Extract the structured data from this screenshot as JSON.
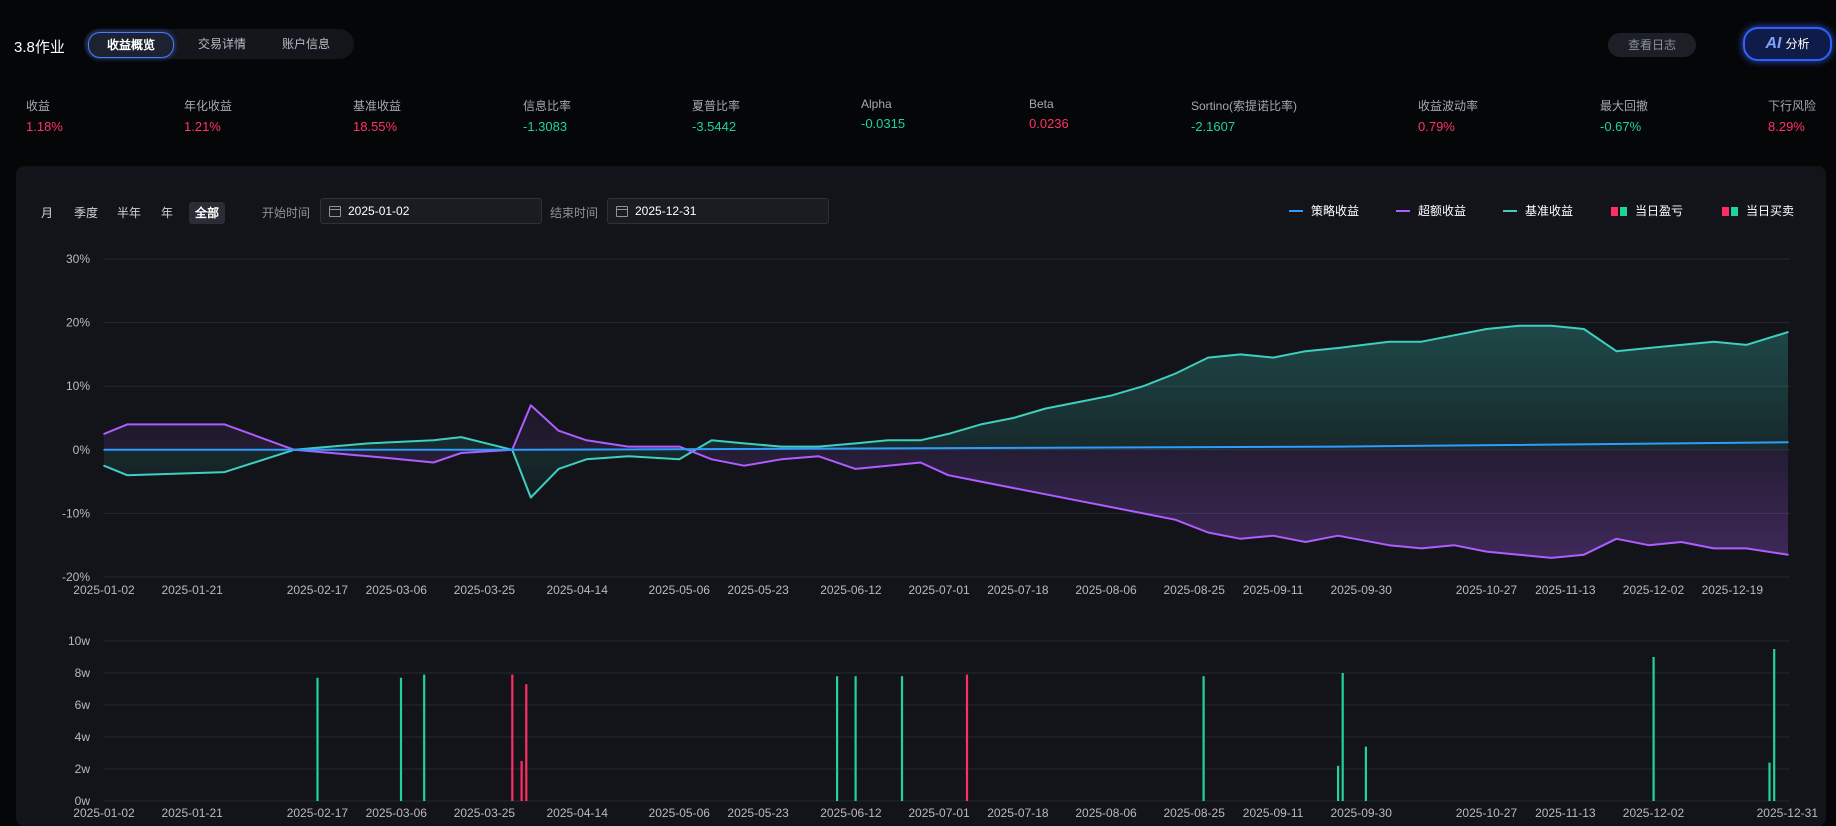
{
  "app": {
    "title": "3.8作业"
  },
  "tabs": [
    {
      "label": "收益概览",
      "active": true
    },
    {
      "label": "交易详情",
      "active": false
    },
    {
      "label": "账户信息",
      "active": false
    }
  ],
  "toolbar": {
    "log_label": "查看日志",
    "ai_icon": "AI",
    "ai_label": "分析"
  },
  "metrics": [
    {
      "label": "收益",
      "value": "1.18%",
      "tone": "red"
    },
    {
      "label": "年化收益",
      "value": "1.21%",
      "tone": "red"
    },
    {
      "label": "基准收益",
      "value": "18.55%",
      "tone": "red"
    },
    {
      "label": "信息比率",
      "value": "-1.3083",
      "tone": "green"
    },
    {
      "label": "夏普比率",
      "value": "-3.5442",
      "tone": "green"
    },
    {
      "label": "Alpha",
      "value": "-0.0315",
      "tone": "green"
    },
    {
      "label": "Beta",
      "value": "0.0236",
      "tone": "red"
    },
    {
      "label": "Sortino(索提诺比率)",
      "value": "-2.1607",
      "tone": "green"
    },
    {
      "label": "收益波动率",
      "value": "0.79%",
      "tone": "red"
    },
    {
      "label": "最大回撤",
      "value": "-0.67%",
      "tone": "green"
    },
    {
      "label": "下行风险",
      "value": "8.29%",
      "tone": "red"
    }
  ],
  "periods": [
    {
      "label": "月",
      "active": false
    },
    {
      "label": "季度",
      "active": false
    },
    {
      "label": "半年",
      "active": false
    },
    {
      "label": "年",
      "active": false
    },
    {
      "label": "全部",
      "active": true
    }
  ],
  "date_range": {
    "start_label": "开始时间",
    "start_value": "2025-01-02",
    "end_label": "结束时间",
    "end_value": "2025-12-31"
  },
  "legend": [
    {
      "label": "策略收益",
      "kind": "line",
      "colors": [
        "#2e9bff"
      ]
    },
    {
      "label": "超额收益",
      "kind": "line",
      "colors": [
        "#b05cff"
      ]
    },
    {
      "label": "基准收益",
      "kind": "line",
      "colors": [
        "#3ecfc0"
      ]
    },
    {
      "label": "当日盈亏",
      "kind": "square",
      "colors": [
        "#ff2e63",
        "#1fd39a"
      ]
    },
    {
      "label": "当日买卖",
      "kind": "square",
      "colors": [
        "#ff2e63",
        "#1fd39a"
      ]
    }
  ],
  "colors": {
    "strategy": "#2e9bff",
    "excess": "#b05cff",
    "benchmark": "#3ecfc0",
    "up": "#ff2e63",
    "down": "#1fd39a"
  },
  "chart_data": [
    {
      "type": "line",
      "x_ticks": [
        "2025-01-02",
        "2025-01-21",
        "2025-02-17",
        "2025-03-06",
        "2025-03-25",
        "2025-04-14",
        "2025-05-06",
        "2025-05-23",
        "2025-06-12",
        "2025-07-01",
        "2025-07-18",
        "2025-08-06",
        "2025-08-25",
        "2025-09-11",
        "2025-09-30",
        "2025-10-27",
        "2025-11-13",
        "2025-12-02",
        "2025-12-19"
      ],
      "y_ticks": [
        "30%",
        "20%",
        "10%",
        "0%",
        "-10%",
        "-20%"
      ],
      "ylim": [
        -20,
        30
      ],
      "series": [
        {
          "name": "策略收益",
          "x": [
            "2025-01-02",
            "2025-04-02",
            "2025-09-25",
            "2025-12-31"
          ],
          "values": [
            0,
            0,
            0.5,
            1.18
          ]
        },
        {
          "name": "超额收益",
          "x": [
            "2025-01-02",
            "2025-01-07",
            "2025-01-28",
            "2025-02-12",
            "2025-02-28",
            "2025-03-14",
            "2025-03-20",
            "2025-03-31",
            "2025-04-04",
            "2025-04-10",
            "2025-04-16",
            "2025-04-25",
            "2025-05-06",
            "2025-05-13",
            "2025-05-20",
            "2025-05-28",
            "2025-06-05",
            "2025-06-13",
            "2025-06-20",
            "2025-06-27",
            "2025-07-03",
            "2025-07-10",
            "2025-07-17",
            "2025-07-24",
            "2025-07-31",
            "2025-08-07",
            "2025-08-14",
            "2025-08-21",
            "2025-08-28",
            "2025-09-04",
            "2025-09-11",
            "2025-09-18",
            "2025-09-25",
            "2025-10-06",
            "2025-10-13",
            "2025-10-20",
            "2025-10-27",
            "2025-11-03",
            "2025-11-10",
            "2025-11-17",
            "2025-11-24",
            "2025-12-01",
            "2025-12-08",
            "2025-12-15",
            "2025-12-22",
            "2025-12-31"
          ],
          "values": [
            2.5,
            4,
            4,
            0,
            -1,
            -2,
            -0.5,
            0,
            7,
            3,
            1.5,
            0.5,
            0.5,
            -1.5,
            -2.5,
            -1.5,
            -1,
            -3,
            -2.5,
            -2,
            -4,
            -5,
            -6,
            -7,
            -8,
            -9,
            -10,
            -11,
            -13,
            -14,
            -13.5,
            -14.5,
            -13.5,
            -15,
            -15.5,
            -15,
            -16,
            -16.5,
            -17,
            -16.5,
            -14,
            -15,
            -14.5,
            -15.5,
            -15.5,
            -16.5
          ]
        },
        {
          "name": "基准收益",
          "x": [
            "2025-01-02",
            "2025-01-07",
            "2025-01-28",
            "2025-02-12",
            "2025-02-28",
            "2025-03-14",
            "2025-03-20",
            "2025-03-31",
            "2025-04-04",
            "2025-04-10",
            "2025-04-16",
            "2025-04-25",
            "2025-05-06",
            "2025-05-13",
            "2025-05-20",
            "2025-05-28",
            "2025-06-05",
            "2025-06-13",
            "2025-06-20",
            "2025-06-27",
            "2025-07-03",
            "2025-07-10",
            "2025-07-17",
            "2025-07-24",
            "2025-07-31",
            "2025-08-07",
            "2025-08-14",
            "2025-08-21",
            "2025-08-28",
            "2025-09-04",
            "2025-09-11",
            "2025-09-18",
            "2025-09-25",
            "2025-10-06",
            "2025-10-13",
            "2025-10-20",
            "2025-10-27",
            "2025-11-03",
            "2025-11-10",
            "2025-11-17",
            "2025-11-24",
            "2025-12-01",
            "2025-12-08",
            "2025-12-15",
            "2025-12-22",
            "2025-12-31"
          ],
          "values": [
            -2.5,
            -4,
            -3.5,
            0,
            1,
            1.5,
            2,
            0,
            -7.5,
            -3,
            -1.5,
            -1,
            -1.5,
            1.5,
            1,
            0.5,
            0.5,
            1,
            1.5,
            1.5,
            2.5,
            4,
            5,
            6.5,
            7.5,
            8.5,
            10,
            12,
            14.5,
            15,
            14.5,
            15.5,
            16,
            17,
            17,
            18,
            19,
            19.5,
            19.5,
            19,
            15.5,
            16,
            16.5,
            17,
            16.5,
            18.5
          ]
        }
      ]
    },
    {
      "type": "bar",
      "x_ticks": [
        "2025-01-02",
        "2025-01-21",
        "2025-02-17",
        "2025-03-06",
        "2025-03-25",
        "2025-04-14",
        "2025-05-06",
        "2025-05-23",
        "2025-06-12",
        "2025-07-01",
        "2025-07-18",
        "2025-08-06",
        "2025-08-25",
        "2025-09-11",
        "2025-09-30",
        "2025-10-27",
        "2025-11-13",
        "2025-12-02",
        "2025-12-31"
      ],
      "y_ticks": [
        "10w",
        "8w",
        "6w",
        "4w",
        "2w",
        "0w"
      ],
      "ylim": [
        0,
        10
      ],
      "unit": "w",
      "bars": [
        {
          "date": "2025-02-17",
          "value": 7.7,
          "side": "down"
        },
        {
          "date": "2025-03-07",
          "value": 7.7,
          "side": "down"
        },
        {
          "date": "2025-03-12",
          "value": 7.9,
          "side": "down"
        },
        {
          "date": "2025-03-31",
          "value": 7.9,
          "side": "up"
        },
        {
          "date": "2025-04-02",
          "value": 2.5,
          "side": "up"
        },
        {
          "date": "2025-04-03",
          "value": 7.3,
          "side": "up"
        },
        {
          "date": "2025-06-09",
          "value": 7.8,
          "side": "down"
        },
        {
          "date": "2025-06-13",
          "value": 7.8,
          "side": "down"
        },
        {
          "date": "2025-06-23",
          "value": 7.8,
          "side": "down"
        },
        {
          "date": "2025-07-07",
          "value": 7.9,
          "side": "up"
        },
        {
          "date": "2025-08-27",
          "value": 7.8,
          "side": "down"
        },
        {
          "date": "2025-09-25",
          "value": 2.2,
          "side": "down"
        },
        {
          "date": "2025-09-26",
          "value": 8.0,
          "side": "down"
        },
        {
          "date": "2025-10-01",
          "value": 3.4,
          "side": "down"
        },
        {
          "date": "2025-12-02",
          "value": 9.0,
          "side": "down"
        },
        {
          "date": "2025-12-27",
          "value": 2.4,
          "side": "down"
        },
        {
          "date": "2025-12-28",
          "value": 9.5,
          "side": "down"
        }
      ]
    }
  ]
}
